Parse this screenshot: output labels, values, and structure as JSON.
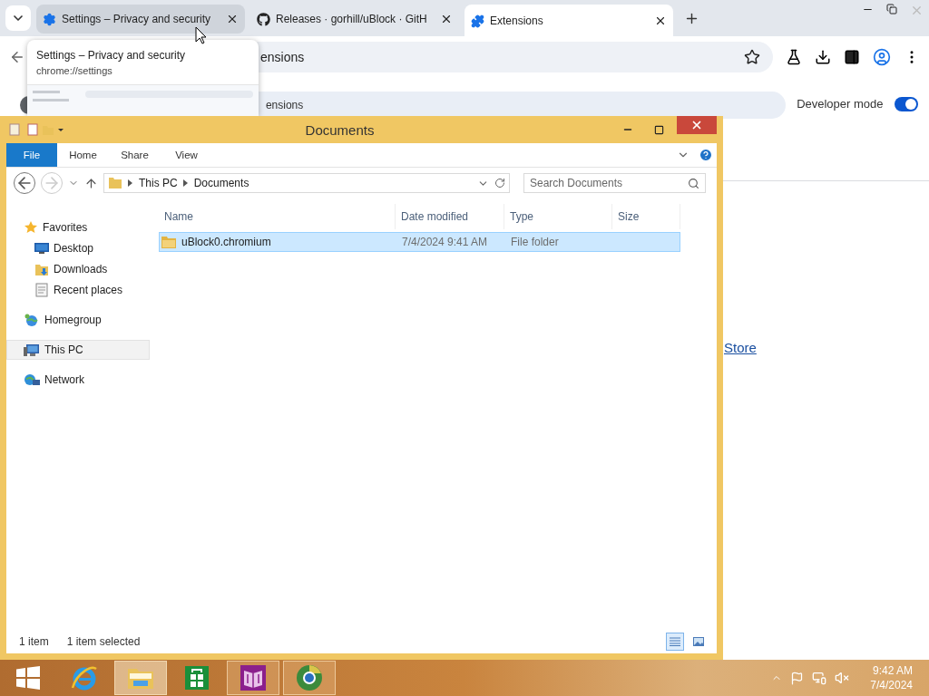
{
  "browser": {
    "tabs": [
      {
        "kind": "gear",
        "title": "Settings – Privacy and security",
        "selected": false,
        "hovered": true
      },
      {
        "kind": "github",
        "title": "Releases · gorhill/uBlock · GitH",
        "selected": false,
        "hovered": false
      },
      {
        "kind": "puzzle",
        "title": "Extensions",
        "selected": true,
        "hovered": false
      }
    ],
    "address": "ensions",
    "tooltip": {
      "title": "Settings – Privacy and security",
      "url": "chrome://settings"
    },
    "search_text": "ensions",
    "developer_mode": {
      "label": "Developer mode",
      "on": true
    },
    "store_link": "Store"
  },
  "explorer": {
    "title": "Documents",
    "ribbon_tabs": [
      {
        "label": "File",
        "kind": "file"
      },
      {
        "label": "Home",
        "kind": "tab"
      },
      {
        "label": "Share",
        "kind": "tab"
      },
      {
        "label": "View",
        "kind": "tab"
      }
    ],
    "breadcrumb": [
      "This PC",
      "Documents"
    ],
    "search_placeholder": "Search Documents",
    "columns": [
      "Name",
      "Date modified",
      "Type",
      "Size"
    ],
    "rows": [
      {
        "name": "uBlock0.chromium",
        "date_modified": "7/4/2024 9:41 AM",
        "type": "File folder",
        "selected": true
      }
    ],
    "nav": [
      {
        "label": "Favorites",
        "kind": "star",
        "selected": false,
        "children": [
          {
            "label": "Desktop",
            "kind": "desktop",
            "selected": false
          },
          {
            "label": "Downloads",
            "kind": "downloads",
            "selected": false
          },
          {
            "label": "Recent places",
            "kind": "recent",
            "selected": false
          }
        ]
      },
      {
        "label": "Homegroup",
        "kind": "homegroup",
        "selected": false
      },
      {
        "label": "This PC",
        "kind": "pc",
        "selected": true
      },
      {
        "label": "Network",
        "kind": "network",
        "selected": false
      }
    ],
    "status": [
      "1 item",
      "1 item selected"
    ],
    "view_buttons": [
      {
        "kind": "details",
        "selected": true
      },
      {
        "kind": "icons",
        "selected": false
      }
    ]
  },
  "taskbar": {
    "apps": [
      {
        "kind": "ie",
        "selected": false,
        "running": false
      },
      {
        "kind": "explorer",
        "selected": true,
        "running": true
      },
      {
        "kind": "store",
        "selected": false,
        "running": false
      },
      {
        "kind": "reader",
        "selected": false,
        "running": true
      },
      {
        "kind": "chrome",
        "selected": false,
        "running": true
      }
    ],
    "time": "9:42 AM",
    "date": "7/4/2024",
    "volume_muted": true
  }
}
